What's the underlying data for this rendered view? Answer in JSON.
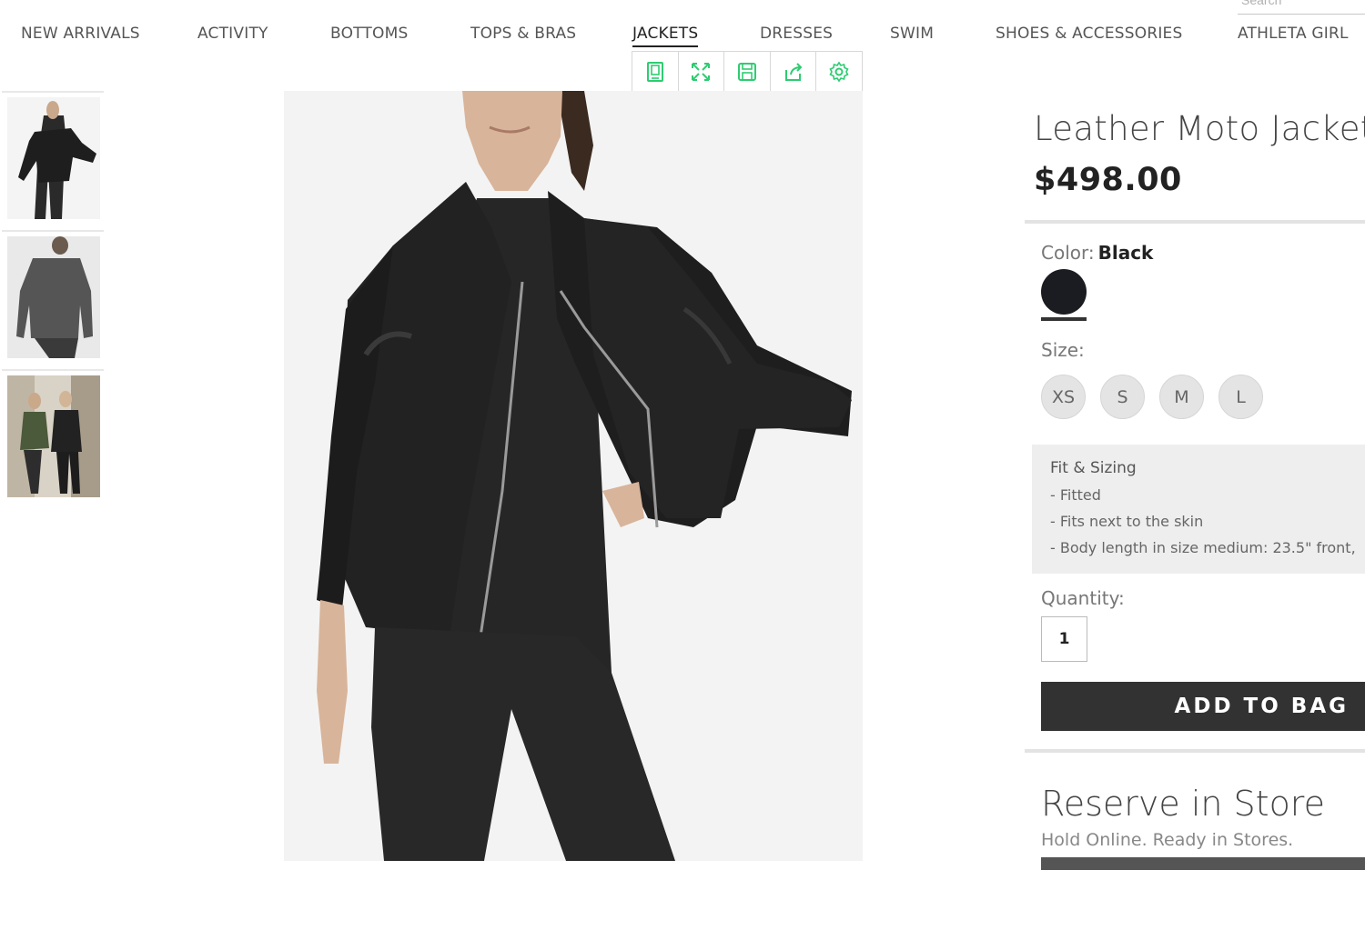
{
  "search": {
    "placeholder": "Search"
  },
  "nav": {
    "items": [
      {
        "label": "NEW ARRIVALS"
      },
      {
        "label": "ACTIVITY"
      },
      {
        "label": "BOTTOMS"
      },
      {
        "label": "TOPS & BRAS"
      },
      {
        "label": "JACKETS",
        "active": true
      },
      {
        "label": "DRESSES"
      },
      {
        "label": "SWIM"
      },
      {
        "label": "SHOES & ACCESSORIES"
      },
      {
        "label": "ATHLETA GIRL"
      }
    ]
  },
  "image_toolbar": {
    "icons": [
      "bookmark-icon",
      "expand-icon",
      "save-icon",
      "share-icon",
      "settings-icon"
    ],
    "accent_color": "#2ecc71"
  },
  "product": {
    "title": "Leather Moto Jacket",
    "price": "$498.00",
    "color_label": "Color:",
    "color_value": "Black",
    "swatch_color": "#1b1c21",
    "size_label": "Size:",
    "sizes": [
      "XS",
      "S",
      "M",
      "L"
    ],
    "fit": {
      "title": "Fit & Sizing",
      "lines": [
        "- Fitted",
        "- Fits next to the skin",
        "- Body length in size medium: 23.5\" front,"
      ]
    },
    "quantity_label": "Quantity:",
    "quantity": "1",
    "add_to_bag": "ADD TO BAG"
  },
  "reserve": {
    "title": "Reserve in Store",
    "subtitle": "Hold Online. Ready in Stores."
  }
}
